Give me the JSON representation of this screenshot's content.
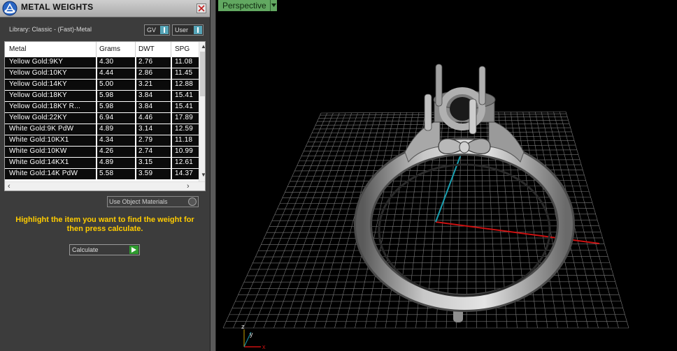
{
  "panel": {
    "title": "METAL WEIGHTS",
    "library_label": "Library: Classic - (Fast)-Metal",
    "dropdown_gv": "GV",
    "dropdown_user": "User",
    "use_object_materials": "Use Object Materials",
    "hint": "Highlight the item you want to find the weight for then press calculate.",
    "calculate_label": "Calculate"
  },
  "table": {
    "columns": [
      "Metal",
      "Grams",
      "DWT",
      "SPG"
    ],
    "rows": [
      {
        "metal": "Yellow Gold:9KY",
        "grams": "4.30",
        "dwt": "2.76",
        "spg": "11.08"
      },
      {
        "metal": "Yellow Gold:10KY",
        "grams": "4.44",
        "dwt": "2.86",
        "spg": "11.45"
      },
      {
        "metal": "Yellow Gold:14KY",
        "grams": "5.00",
        "dwt": "3.21",
        "spg": "12.88"
      },
      {
        "metal": "Yellow Gold:18KY",
        "grams": "5.98",
        "dwt": "3.84",
        "spg": "15.41"
      },
      {
        "metal": "Yellow Gold:18KY R...",
        "grams": "5.98",
        "dwt": "3.84",
        "spg": "15.41"
      },
      {
        "metal": "Yellow Gold:22KY",
        "grams": "6.94",
        "dwt": "4.46",
        "spg": "17.89"
      },
      {
        "metal": "White Gold:9K PdW",
        "grams": "4.89",
        "dwt": "3.14",
        "spg": "12.59"
      },
      {
        "metal": "White Gold:10KX1",
        "grams": "4.34",
        "dwt": "2.79",
        "spg": "11.18"
      },
      {
        "metal": "White Gold:10KW",
        "grams": "4.26",
        "dwt": "2.74",
        "spg": "10.99"
      },
      {
        "metal": "White Gold:14KX1",
        "grams": "4.89",
        "dwt": "3.15",
        "spg": "12.61"
      },
      {
        "metal": "White Gold:14K PdW",
        "grams": "5.58",
        "dwt": "3.59",
        "spg": "14.37"
      }
    ]
  },
  "viewport": {
    "view_name": "Perspective",
    "axis_labels": {
      "z": "z",
      "y": "y",
      "x": "x"
    }
  },
  "colors": {
    "panel_bg": "#3c3c3c",
    "accent_teal": "#55a4b7",
    "hint_yellow": "#ffcc00",
    "view_label_green": "#62a861",
    "axis_x_red": "#cc1111",
    "axis_y_teal": "#1aa0b0"
  }
}
